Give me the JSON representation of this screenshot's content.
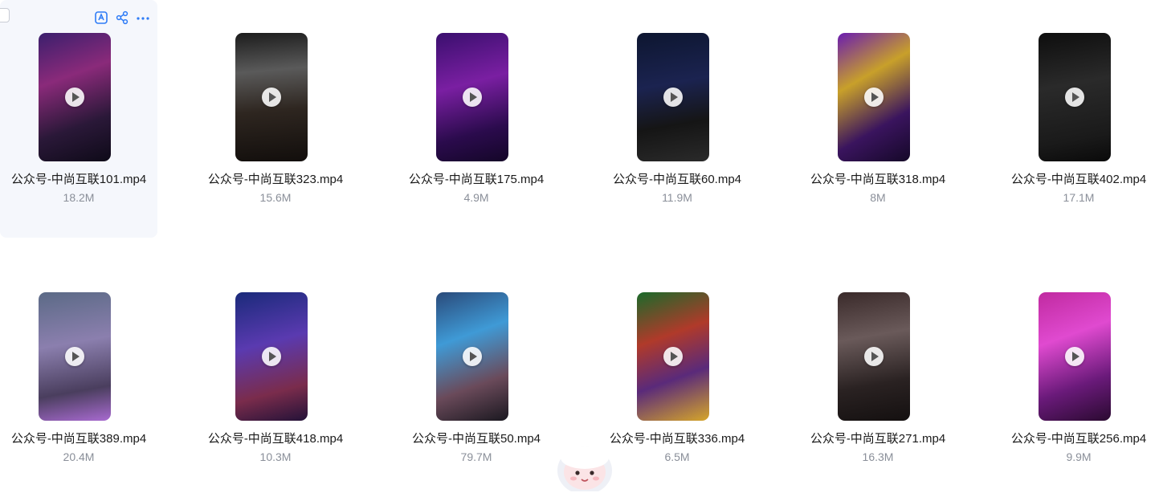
{
  "toolbar": {
    "icons": [
      "save-to-drive-icon",
      "share-icon",
      "more-icon"
    ],
    "accent_color": "#2f7cf6"
  },
  "files": [
    {
      "name": "公众号-中尚互联101.mp4",
      "size": "18.2M",
      "selected": true
    },
    {
      "name": "公众号-中尚互联323.mp4",
      "size": "15.6M"
    },
    {
      "name": "公众号-中尚互联175.mp4",
      "size": "4.9M"
    },
    {
      "name": "公众号-中尚互联60.mp4",
      "size": "11.9M"
    },
    {
      "name": "公众号-中尚互联318.mp4",
      "size": "8M"
    },
    {
      "name": "公众号-中尚互联402.mp4",
      "size": "17.1M"
    },
    {
      "name": "公众号-中尚互联389.mp4",
      "size": "20.4M"
    },
    {
      "name": "公众号-中尚互联418.mp4",
      "size": "10.3M"
    },
    {
      "name": "公众号-中尚互联50.mp4",
      "size": "79.7M"
    },
    {
      "name": "公众号-中尚互联336.mp4",
      "size": "6.5M"
    },
    {
      "name": "公众号-中尚互联271.mp4",
      "size": "16.3M"
    },
    {
      "name": "公众号-中尚互联256.mp4",
      "size": "9.9M"
    }
  ],
  "mascot_icon": "assistant-mascot-icon"
}
